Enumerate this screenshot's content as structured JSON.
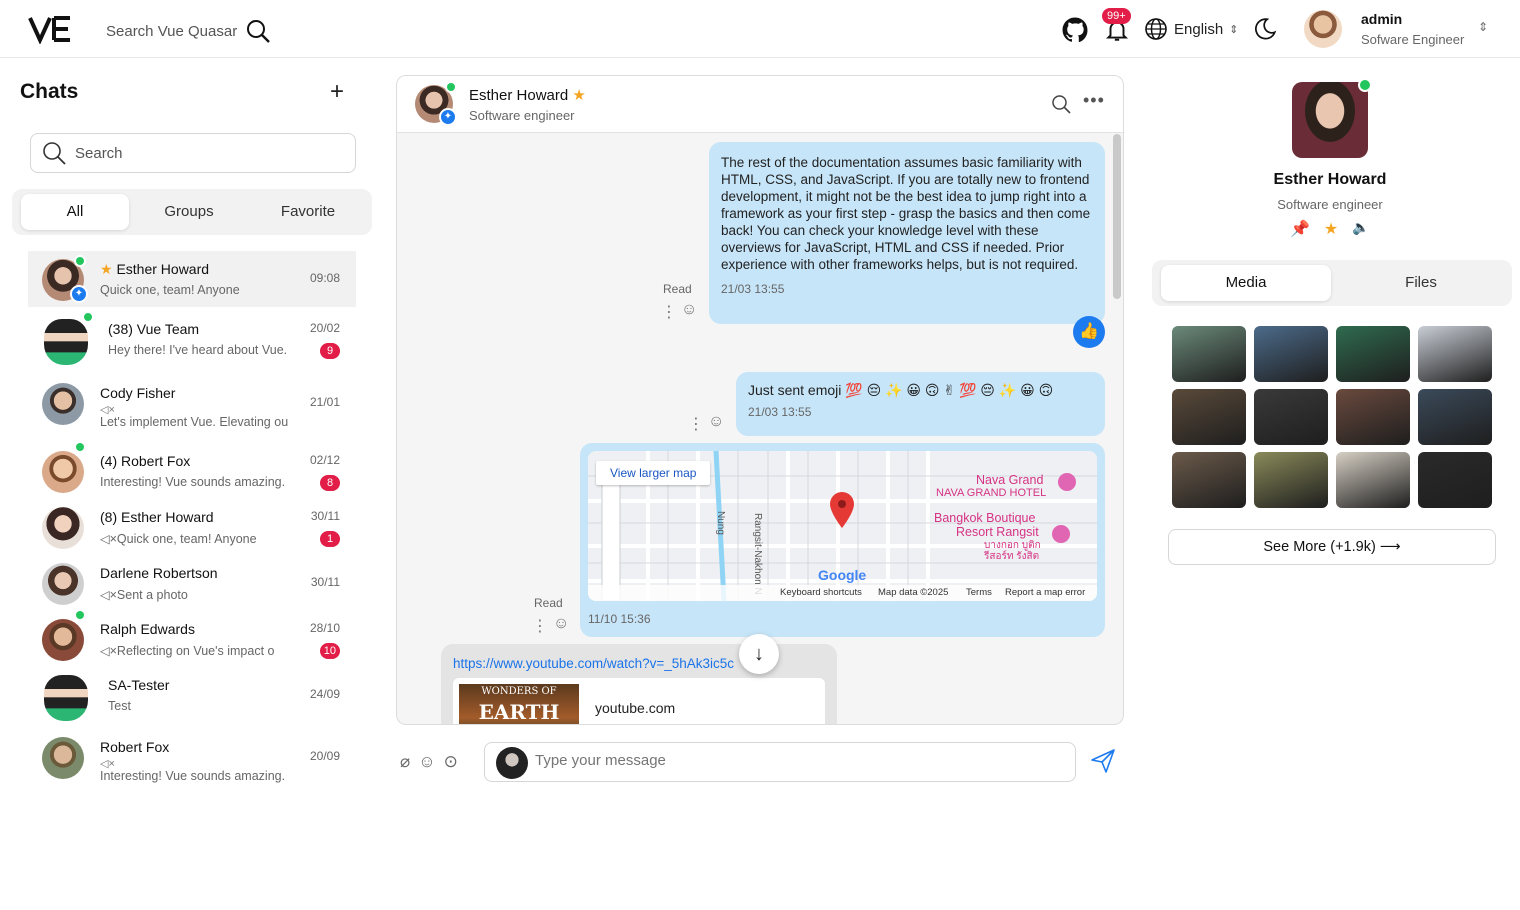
{
  "header": {
    "search_placeholder": "Search Vue Quasar",
    "notif_count": "99+",
    "language": "English",
    "user_name": "admin",
    "user_role": "Sofware Engineer"
  },
  "sidebar": {
    "title": "Chats",
    "search_placeholder": "Search",
    "tabs": [
      "All",
      "Groups",
      "Favorite"
    ],
    "chats": [
      {
        "name": "Esther Howard",
        "preview": "Quick one, team! Anyone",
        "time": "09:08",
        "badge": ""
      },
      {
        "name": "(38) Vue Team",
        "preview": "Hey there! I've heard about Vue.",
        "time": "20/02",
        "badge": "9"
      },
      {
        "name": "Cody Fisher",
        "preview": "Let's implement Vue. Elevating ou",
        "time": "21/01",
        "badge": ""
      },
      {
        "name": "(4) Robert Fox",
        "preview": "Interesting! Vue sounds amazing.",
        "time": "02/12",
        "badge": "8"
      },
      {
        "name": "(8) Esther Howard",
        "preview": "Quick one, team! Anyone",
        "time": "30/11",
        "badge": "1"
      },
      {
        "name": "Darlene Robertson",
        "preview": "Sent a photo",
        "time": "30/11",
        "badge": ""
      },
      {
        "name": "Ralph Edwards",
        "preview": "Reflecting on Vue's impact o",
        "time": "28/10",
        "badge": "10"
      },
      {
        "name": "SA-Tester",
        "preview": "Test",
        "time": "24/09",
        "badge": ""
      },
      {
        "name": "Robert Fox",
        "preview": "Interesting! Vue sounds amazing.",
        "time": "20/09",
        "badge": ""
      }
    ]
  },
  "chat": {
    "contact_name": "Esther Howard",
    "contact_role": "Software engineer",
    "messages": [
      {
        "text": "The rest of the documentation assumes basic familiarity with HTML, CSS, and JavaScript. If you are totally new to frontend development, it might not be the best idea to jump right into a framework as your first step - grasp the basics and then come back! You can check your knowledge level with these overviews for JavaScript, HTML and CSS if needed. Prior experience with other frameworks helps, but is not required.",
        "time": "21/03 13:55",
        "status": "Read"
      },
      {
        "text": "Just sent emoji 💯 😔 ✨ 😀 🙃 ✌ 💯 😔 ✨ 😀 🙃",
        "time": "21/03 13:55"
      },
      {
        "time": "11/10 15:36",
        "status": "Read",
        "map": {
          "button": "View larger map",
          "places": [
            "Nava Grand",
            "NAVA GRAND HOTEL",
            "Bangkok Boutique",
            "Resort Rangsit",
            "บางกอก บูติก",
            "รีสอร์ท รังสิต"
          ],
          "roads": [
            "Rangsit-Nakhon N",
            "Nung"
          ],
          "brand": "Google",
          "footer": [
            "Keyboard shortcuts",
            "Map data ©2025",
            "Terms",
            "Report a map error"
          ]
        }
      },
      {
        "link": "https://www.youtube.com/watch?v=_5hAk3ic5c",
        "domain": "youtube.com",
        "thumb_small": "WONDERS OF",
        "thumb_big": "EARTH"
      }
    ],
    "composer_placeholder": "Type your message"
  },
  "profile": {
    "name": "Esther Howard",
    "role": "Software engineer",
    "tabs": [
      "Media",
      "Files"
    ],
    "see_more": "See More (+1.9k)",
    "media_colors": [
      "#6b8a7a",
      "#4c6b8a",
      "#2f6b4f",
      "#c9ced6",
      "#5a4a3a",
      "#3a3a3a",
      "#6a4a3e",
      "#3b4a5a",
      "#6b5a4a",
      "#8a8a5a",
      "#d6cfc4",
      "#2a2a2a"
    ]
  }
}
